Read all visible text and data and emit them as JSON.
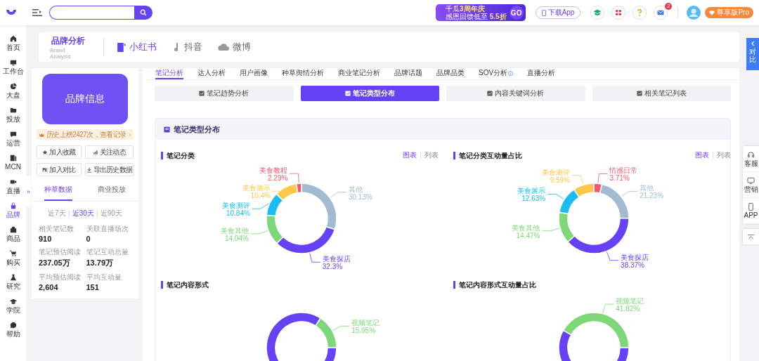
{
  "topbar": {
    "promo": {
      "top": "千瓜",
      "top_highlight": "3周年庆",
      "bottom": "感恩回馈低至",
      "bottom_highlight": "5.5折",
      "go": "GO"
    },
    "download": "下载App",
    "mail_badge": "2",
    "pro": "尊享版Pro"
  },
  "sidebar": {
    "items": [
      {
        "label": "首页",
        "selected": false
      },
      {
        "label": "工作台",
        "selected": false
      },
      {
        "label": "大盘",
        "selected": false
      },
      {
        "label": "投放",
        "selected": false
      },
      {
        "label": "运营",
        "selected": false
      },
      {
        "label": "MCN",
        "selected": false
      },
      {
        "label": "直播",
        "selected": false
      },
      {
        "label": "品牌",
        "selected": true
      },
      {
        "label": "商品",
        "selected": false
      },
      {
        "label": "购买",
        "selected": false
      },
      {
        "label": "研究",
        "selected": false
      },
      {
        "label": "学院",
        "selected": false
      },
      {
        "label": "帮助",
        "selected": false
      }
    ],
    "expand_handle": "»"
  },
  "header": {
    "title": "品牌分析",
    "subtitle": "Brand Analysis",
    "platforms": [
      {
        "label": "小红书",
        "selected": true
      },
      {
        "label": "抖音",
        "selected": false
      },
      {
        "label": "微博",
        "selected": false
      }
    ]
  },
  "brand_panel": {
    "logo_text": "品牌信息",
    "history": "历史上榜2427次，查看记录",
    "actions": [
      "加入收藏",
      "关注动态",
      "加入对比",
      "导出历史数据"
    ],
    "tabs": [
      {
        "label": "种草数据",
        "selected": true
      },
      {
        "label": "商业投放",
        "selected": false
      }
    ],
    "periods": [
      {
        "label": "近7天",
        "selected": false
      },
      {
        "label": "近30天",
        "selected": true
      },
      {
        "label": "近90天",
        "selected": false
      }
    ],
    "stats": [
      {
        "label": "相关笔记数",
        "value": "910"
      },
      {
        "label": "关联直播场次",
        "value": "0"
      },
      {
        "label": "笔记预估阅读",
        "value": "237.05万"
      },
      {
        "label": "笔记互动总量",
        "value": "13.79万"
      },
      {
        "label": "平均预估阅读",
        "value": "2,604"
      },
      {
        "label": "平均互动量",
        "value": "151"
      }
    ]
  },
  "analysis": {
    "tabs": [
      {
        "label": "笔记分析",
        "selected": true
      },
      {
        "label": "达人分析",
        "selected": false
      },
      {
        "label": "用户画像",
        "selected": false
      },
      {
        "label": "种草舆情分析",
        "selected": false
      },
      {
        "label": "商业笔记分析",
        "selected": false
      },
      {
        "label": "品牌话题",
        "selected": false
      },
      {
        "label": "品牌品类",
        "selected": false
      },
      {
        "label": "SOV分析",
        "selected": false,
        "info": true
      },
      {
        "label": "直播分析",
        "selected": false
      }
    ],
    "subtabs": [
      {
        "label": "笔记趋势分析",
        "selected": false
      },
      {
        "label": "笔记类型分布",
        "selected": true
      },
      {
        "label": "内容关键词分析",
        "selected": false
      },
      {
        "label": "相关笔记列表",
        "selected": false
      }
    ],
    "section_title": "笔记类型分布",
    "charts": [
      {
        "toggle": [
          {
            "label": "图表",
            "selected": true
          },
          {
            "label": "列表",
            "selected": false
          }
        ],
        "chart_data": {
          "type": "donut",
          "title": "笔记分类",
          "categories": [
            "其他",
            "美食探店",
            "美食其他",
            "美食测评",
            "美食展示",
            "美食教程"
          ],
          "values": [
            30.13,
            32.3,
            14.04,
            10.84,
            10.4,
            2.29
          ],
          "value_labels": [
            "30.13%",
            "32.3%",
            "14.04%",
            "10.84%",
            "10.4%",
            "2.29%"
          ],
          "colors": [
            "#a3bbd0",
            "#6741f5",
            "#7ed87a",
            "#19bdf2",
            "#fcc74a",
            "#f7566f"
          ]
        }
      },
      {
        "toggle": [
          {
            "label": "图表",
            "selected": true
          },
          {
            "label": "列表",
            "selected": false
          }
        ],
        "chart_data": {
          "type": "donut",
          "title": "笔记分类互动量占比",
          "categories": [
            "情感日常",
            "其他",
            "美食探店",
            "美食其他",
            "美食展示",
            "美食测评"
          ],
          "values": [
            3.71,
            21.23,
            38.37,
            14.47,
            12.63,
            9.59
          ],
          "value_labels": [
            "3.71%",
            "21.23%",
            "38.37%",
            "14.47%",
            "12.63%",
            "9.59%"
          ],
          "colors": [
            "#f7566f",
            "#a3bbd0",
            "#6741f5",
            "#7ed87a",
            "#19bdf2",
            "#fcc74a"
          ]
        }
      },
      {
        "chart_data": {
          "type": "donut",
          "title": "笔记内容形式",
          "categories": [
            "视频笔记",
            null
          ],
          "values": [
            15.95,
            84.05
          ],
          "value_labels": [
            "15.95%",
            null
          ],
          "colors": [
            "#7ed87a",
            "#6741f5"
          ]
        }
      },
      {
        "chart_data": {
          "type": "donut",
          "title": "笔记内容形式互动量占比",
          "categories": [
            "视频笔记",
            null
          ],
          "values": [
            41.82,
            58.18
          ],
          "value_labels": [
            "41.82%",
            null
          ],
          "colors": [
            "#7ed87a",
            "#6741f5"
          ]
        }
      }
    ]
  },
  "compare_tab": "对比",
  "side_tools": [
    "客服",
    "营销",
    "APP"
  ]
}
